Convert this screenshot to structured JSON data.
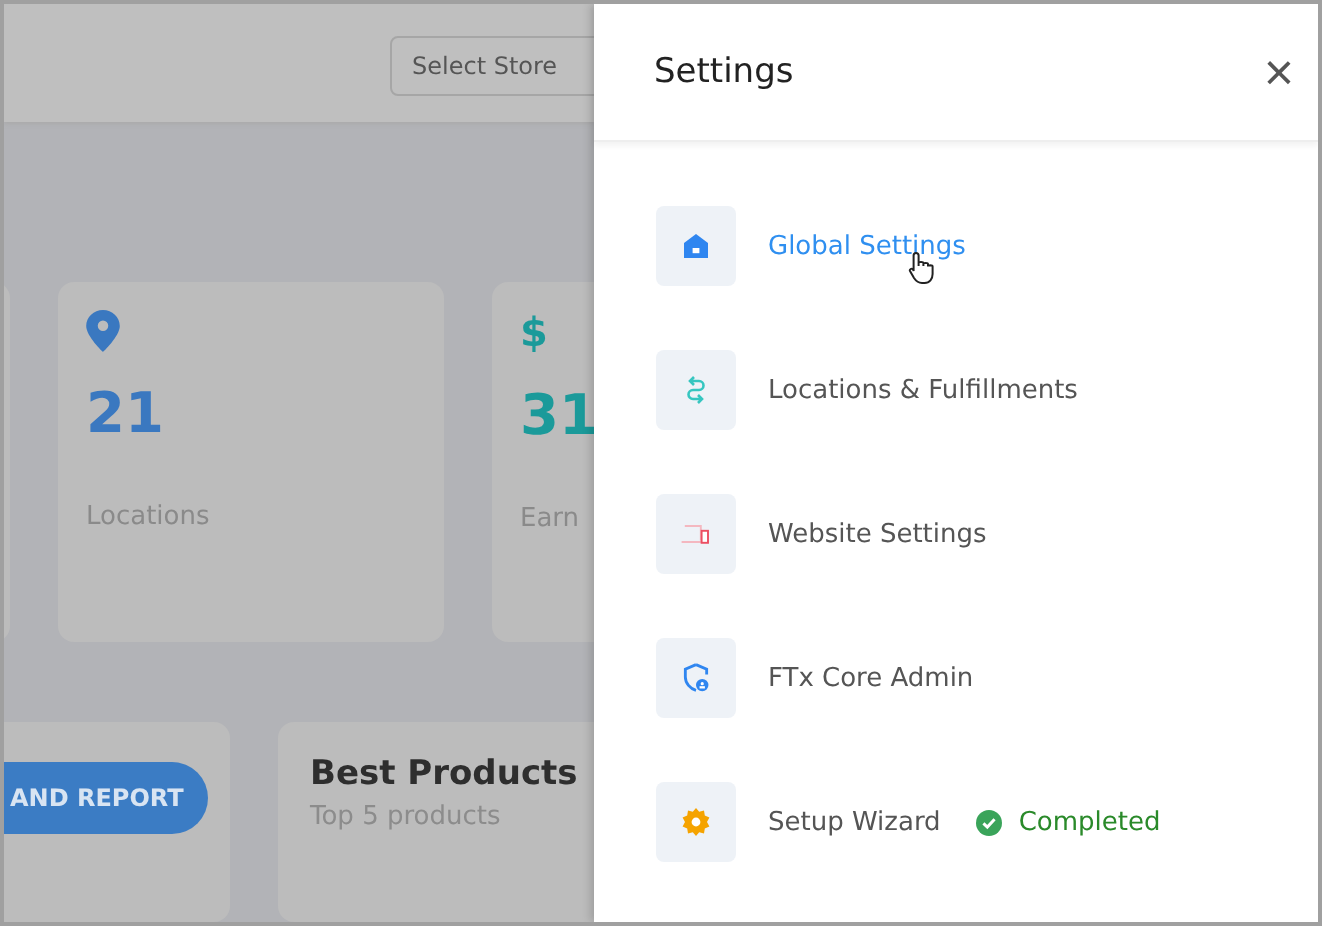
{
  "dashboard": {
    "store_select": {
      "label": "Select Store"
    },
    "stat_cards": [
      {
        "kind": "pin",
        "value": "21",
        "label": "Locations",
        "color": "#3a78c0"
      },
      {
        "kind": "glyph",
        "glyph": "$",
        "value": "31",
        "label": "Earn",
        "color": "#1b9a9a"
      }
    ],
    "report_card": {
      "button": "AND REPORT"
    },
    "products_card": {
      "title": "Best Products",
      "subtitle": "Top 5 products"
    }
  },
  "settings_panel": {
    "title": "Settings",
    "close": "×",
    "items": [
      {
        "label": "Global Settings",
        "highlighted": true
      },
      {
        "label": "Locations & Fulfillments",
        "highlighted": false
      },
      {
        "label": "Website Settings",
        "highlighted": false
      },
      {
        "label": "FTx Core Admin",
        "highlighted": false
      },
      {
        "label": "Setup Wizard",
        "highlighted": false,
        "status": "Completed"
      }
    ]
  }
}
